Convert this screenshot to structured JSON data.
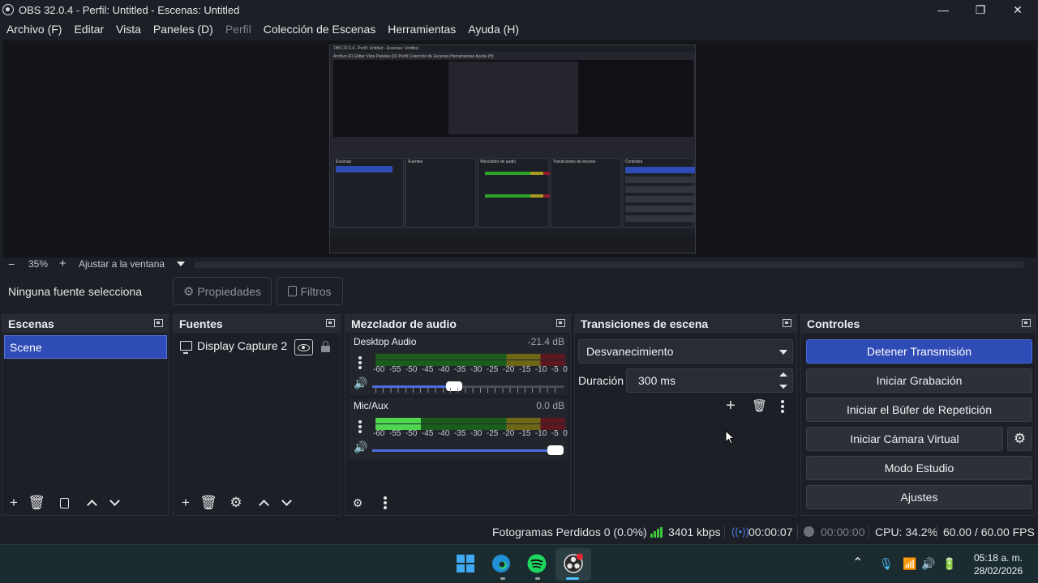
{
  "window": {
    "title": "OBS 32.0.4 - Perfil: Untitled - Escenas: Untitled",
    "minimize_glyph": "—",
    "maximize_glyph": "❐",
    "close_glyph": "✕"
  },
  "menu": [
    {
      "label": "Archivo (F)",
      "disabled": false
    },
    {
      "label": "Editar",
      "disabled": false
    },
    {
      "label": "Vista",
      "disabled": false
    },
    {
      "label": "Paneles (D)",
      "disabled": false
    },
    {
      "label": "Perfil",
      "disabled": true
    },
    {
      "label": "Colección de Escenas",
      "disabled": false
    },
    {
      "label": "Herramientas",
      "disabled": false
    },
    {
      "label": "Ayuda (H)",
      "disabled": false
    }
  ],
  "preview": {
    "nested": {
      "title": "OBS 32.0.4 - Perfil: Untitled - Escenas: Untitled",
      "menu": "Archivo (F)   Editar   Vista   Paneles (D)   Perfil   Colección de Escenas   Herramientas   Ayuda (H)",
      "docks": [
        "Escenas",
        "Fuentes",
        "Mezclador de audio",
        "Transiciones de escena",
        "Controles"
      ]
    }
  },
  "zoom": {
    "minus": "−",
    "level": "35%",
    "plus": "+",
    "fit_label": "Ajustar a la ventana"
  },
  "source_bar": {
    "no_source": "Ninguna fuente selecciona",
    "properties": "Propiedades",
    "filters": "Filtros"
  },
  "scenes": {
    "title": "Escenas",
    "items": [
      "Scene"
    ]
  },
  "sources": {
    "title": "Fuentes",
    "items": [
      "Display Capture 2"
    ]
  },
  "mixer": {
    "title": "Mezclador de audio",
    "scale": [
      "-60",
      "-55",
      "-50",
      "-45",
      "-40",
      "-35",
      "-30",
      "-25",
      "-20",
      "-15",
      "-10",
      "-5",
      "0"
    ],
    "channels": [
      {
        "name": "Desktop Audio",
        "db": "-21.4 dB",
        "level": 0.0,
        "volume": 0.47
      },
      {
        "name": "Mic/Aux",
        "db": "0.0 dB",
        "level": 0.24,
        "volume": 1.0
      }
    ]
  },
  "transitions": {
    "title": "Transiciones de escena",
    "selected": "Desvanecimiento",
    "duration_label": "Duración",
    "duration_value": "300 ms"
  },
  "controls": {
    "title": "Controles",
    "buttons": [
      "Detener Transmisión",
      "Iniciar Grabación",
      "Iniciar el Búfer de Repetición",
      "Iniciar Cámara Virtual",
      "Modo Estudio",
      "Ajustes"
    ]
  },
  "status": {
    "dropped": "Fotogramas Perdidos 0 (0.0%)",
    "bitrate": "3401 kbps",
    "stream_time": "00:00:07",
    "rec_time": "00:00:00",
    "cpu": "CPU: 34.2%",
    "fps": "60.00 / 60.00 FPS"
  },
  "taskbar": {
    "time": "05:18 a. m.",
    "date": "28/02/2026"
  },
  "colors": {
    "accent": "#2f4bb5",
    "background": "#1d1f26",
    "meter_green": "#4fd64f"
  }
}
